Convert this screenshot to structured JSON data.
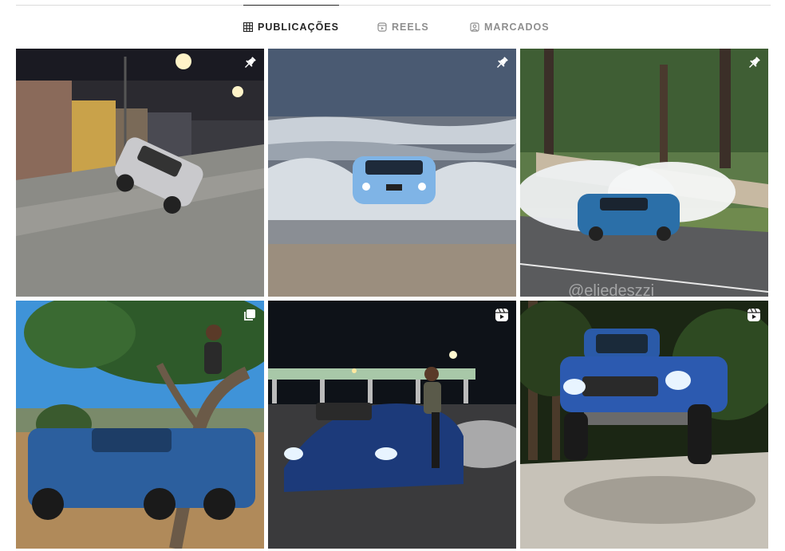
{
  "tabs": [
    {
      "label": "PUBLICAÇÕES",
      "icon": "grid-icon",
      "active": true
    },
    {
      "label": "REELS",
      "icon": "reels-icon",
      "active": false
    },
    {
      "label": "MARCADOS",
      "icon": "tagged-icon",
      "active": false
    }
  ],
  "posts": [
    {
      "subject": "silver hatchback on two wheels, night street",
      "badge": "pin-icon"
    },
    {
      "subject": "light blue BMW coupe driving through sea waves",
      "badge": "pin-icon"
    },
    {
      "subject": "blue BMW sedan drifting with tire smoke",
      "badge": "pin-icon"
    },
    {
      "subject": "man sitting in tree above blue Ford pickup",
      "badge": "carousel-icon"
    },
    {
      "subject": "man standing on blue BMW convertible at toll plaza",
      "badge": "reel-icon"
    },
    {
      "subject": "blue Ford Raptor pickup jumping at night",
      "badge": "reel-icon"
    }
  ],
  "watermark": "@eliedeszzi",
  "colors": {
    "active_tab": "#262626",
    "inactive_tab": "#8e8e8e",
    "divider": "#dbdbdb"
  }
}
